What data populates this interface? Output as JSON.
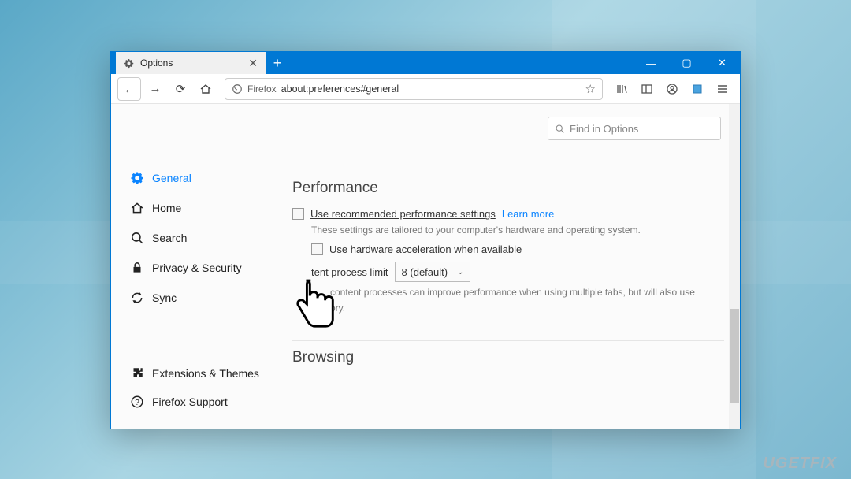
{
  "tab": {
    "title": "Options"
  },
  "urlbar": {
    "prefix": "Firefox",
    "url": "about:preferences#general"
  },
  "search": {
    "placeholder": "Find in Options"
  },
  "sidebar": {
    "items": [
      {
        "label": "General"
      },
      {
        "label": "Home"
      },
      {
        "label": "Search"
      },
      {
        "label": "Privacy & Security"
      },
      {
        "label": "Sync"
      }
    ],
    "bottom": [
      {
        "label": "Extensions & Themes"
      },
      {
        "label": "Firefox Support"
      }
    ]
  },
  "performance": {
    "heading": "Performance",
    "recommended_label": "Use recommended performance settings",
    "learn_more": "Learn more",
    "desc": "These settings are tailored to your computer's hardware and operating system.",
    "hw_accel_label": "Use hardware acceleration when available",
    "content_limit_label": "tent process limit",
    "content_limit_value": "8 (default)",
    "content_desc": "content processes can improve performance when using multiple tabs, but will also use",
    "content_desc2": "ory."
  },
  "browsing": {
    "heading": "Browsing"
  },
  "watermark": "UGETFIX"
}
